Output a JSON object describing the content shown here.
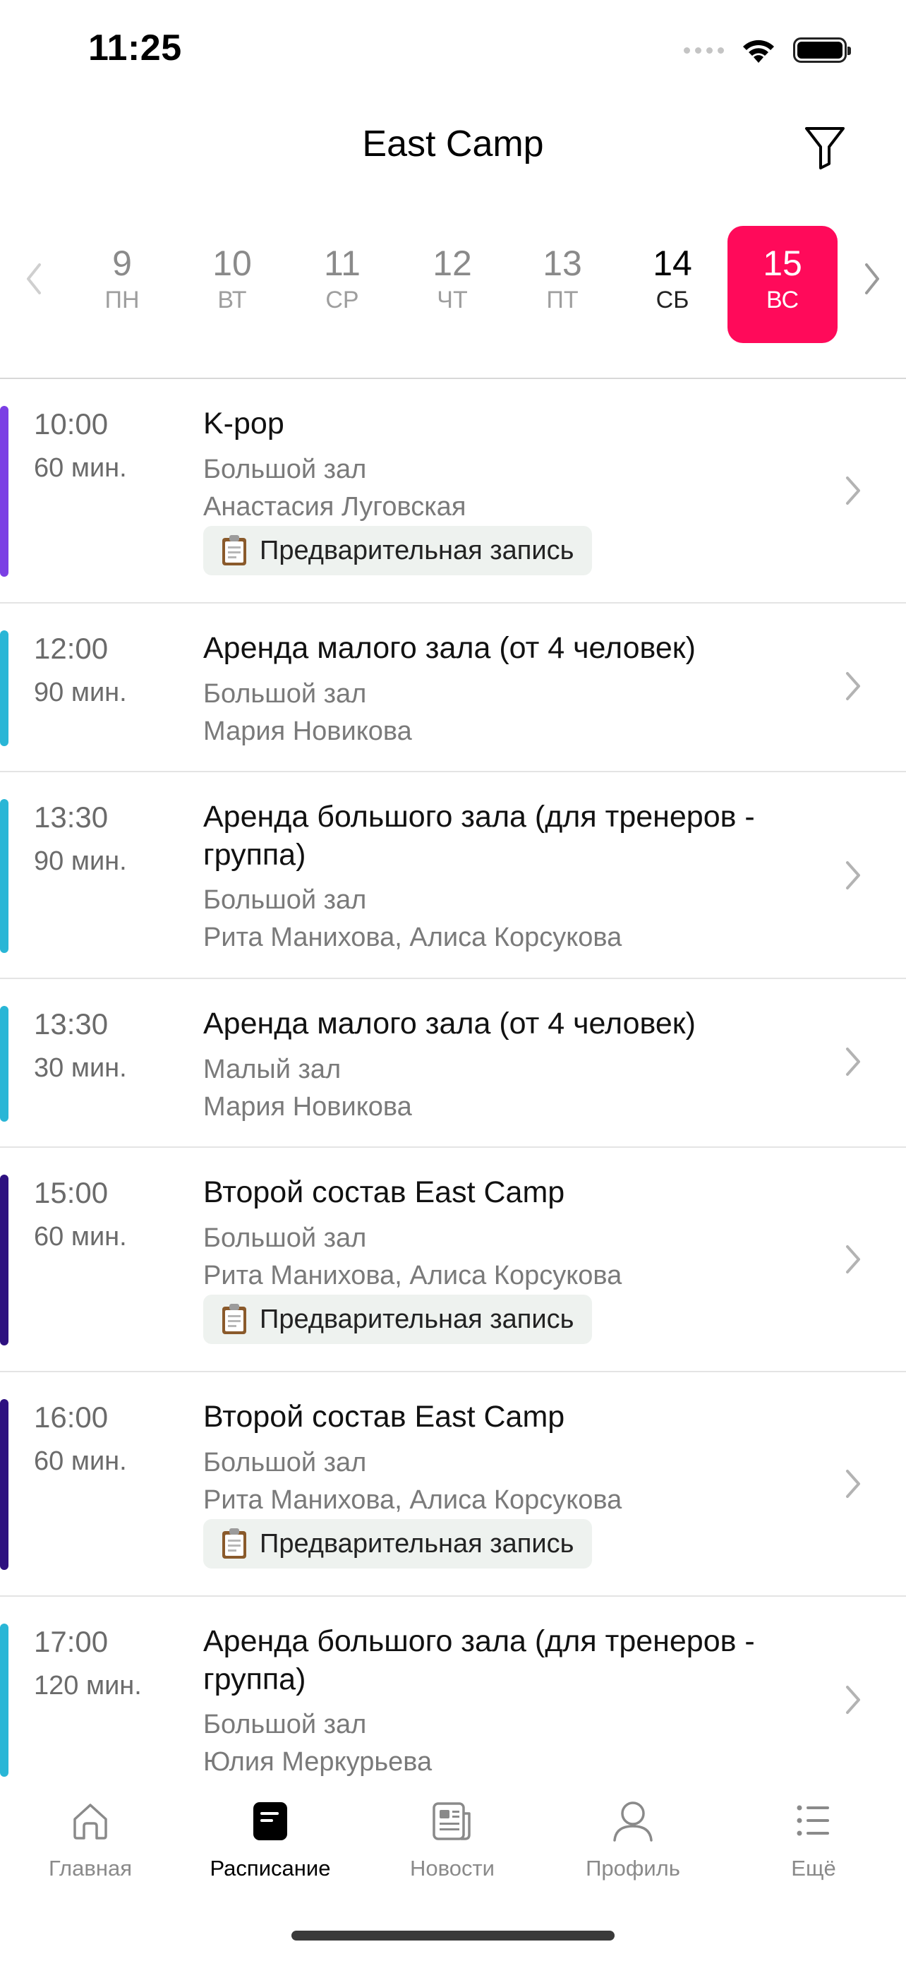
{
  "status_bar": {
    "time": "11:25"
  },
  "header": {
    "title": "East Camp"
  },
  "dates": [
    {
      "num": "9",
      "day": "ПН"
    },
    {
      "num": "10",
      "day": "ВТ"
    },
    {
      "num": "11",
      "day": "СР"
    },
    {
      "num": "12",
      "day": "ЧТ"
    },
    {
      "num": "13",
      "day": "ПТ"
    },
    {
      "num": "14",
      "day": "СБ"
    },
    {
      "num": "15",
      "day": "ВС"
    }
  ],
  "colors": {
    "accent": "#ff0a5a",
    "purple": "#7b3fe4",
    "cyan": "#29b6d6",
    "indigo": "#2e1180"
  },
  "badge_label": "Предварительная запись",
  "events": [
    {
      "time": "10:00",
      "duration": "60 мин.",
      "title": "K-pop",
      "hall": "Большой зал",
      "trainer": "Анастасия Луговская",
      "badge": "Предварительная запись"
    },
    {
      "time": "12:00",
      "duration": "90 мин.",
      "title": "Аренда малого зала (от 4 человек)",
      "hall": "Большой зал",
      "trainer": "Мария Новикова"
    },
    {
      "time": "13:30",
      "duration": "90 мин.",
      "title": "Аренда большого зала (для тренеров - группа)",
      "hall": "Большой зал",
      "trainer": "Рита Манихова, Алиса Корсукова"
    },
    {
      "time": "13:30",
      "duration": "30 мин.",
      "title": "Аренда малого зала (от 4 человек)",
      "hall": "Малый зал",
      "trainer": "Мария Новикова"
    },
    {
      "time": "15:00",
      "duration": "60 мин.",
      "title": "Второй состав East Camp",
      "hall": "Большой зал",
      "trainer": "Рита Манихова, Алиса Корсукова",
      "badge": "Предварительная запись"
    },
    {
      "time": "16:00",
      "duration": "60 мин.",
      "title": "Второй состав East Camp",
      "hall": "Большой зал",
      "trainer": "Рита Манихова, Алиса Корсукова",
      "badge": "Предварительная запись"
    },
    {
      "time": "17:00",
      "duration": "120 мин.",
      "title": "Аренда большого зала (для тренеров - группа)",
      "hall": "Большой зал",
      "trainer": "Юлия Меркурьева"
    }
  ],
  "tabs": [
    {
      "label": "Главная",
      "icon": "home-icon"
    },
    {
      "label": "Расписание",
      "icon": "schedule-icon"
    },
    {
      "label": "Новости",
      "icon": "news-icon"
    },
    {
      "label": "Профиль",
      "icon": "profile-icon"
    },
    {
      "label": "Ещё",
      "icon": "more-icon"
    }
  ]
}
